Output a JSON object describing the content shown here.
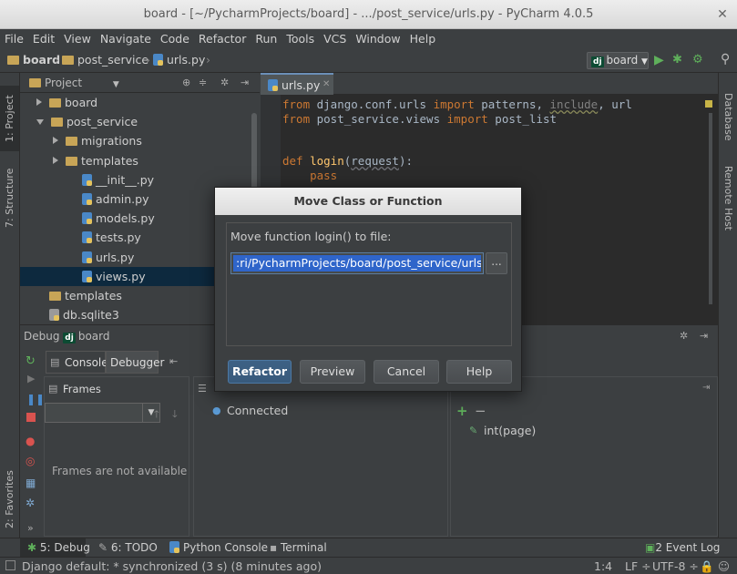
{
  "window": {
    "title": "board - [~/PycharmProjects/board] - .../post_service/urls.py - PyCharm 4.0.5"
  },
  "menu": [
    "File",
    "Edit",
    "View",
    "Navigate",
    "Code",
    "Refactor",
    "Run",
    "Tools",
    "VCS",
    "Window",
    "Help"
  ],
  "breadcrumbs": [
    "board",
    "post_service",
    "urls.py"
  ],
  "run_config": {
    "badge": "dj",
    "name": "board"
  },
  "left_stripe": {
    "project": "1: Project",
    "structure": "7: Structure",
    "favorites": "2: Favorites"
  },
  "right_stripe": {
    "database": "Database",
    "remote": "Remote Host"
  },
  "project": {
    "header": "Project",
    "tree": [
      {
        "label": "board",
        "type": "folder",
        "depth": 1,
        "arrow": "right"
      },
      {
        "label": "post_service",
        "type": "folder",
        "depth": 1,
        "arrow": "down"
      },
      {
        "label": "migrations",
        "type": "folder",
        "depth": 2,
        "arrow": "right"
      },
      {
        "label": "templates",
        "type": "folder",
        "depth": 2,
        "arrow": "right"
      },
      {
        "label": "__init__.py",
        "type": "py",
        "depth": 3
      },
      {
        "label": "admin.py",
        "type": "py",
        "depth": 3
      },
      {
        "label": "models.py",
        "type": "py",
        "depth": 3
      },
      {
        "label": "tests.py",
        "type": "py",
        "depth": 3
      },
      {
        "label": "urls.py",
        "type": "py",
        "depth": 3
      },
      {
        "label": "views.py",
        "type": "py",
        "depth": 3,
        "selected": true
      },
      {
        "label": "templates",
        "type": "folder",
        "depth": 1
      },
      {
        "label": "db.sqlite3",
        "type": "db",
        "depth": 1
      }
    ]
  },
  "editor": {
    "tab": "urls.py",
    "code": {
      "l1": [
        "from",
        " django.conf.urls ",
        "import",
        " patterns, ",
        "include",
        ", url"
      ],
      "l2": [
        "from",
        " post_service.views ",
        "import",
        " post_list"
      ],
      "l3": [
        "def",
        " ",
        "login",
        "(",
        "request",
        "):"
      ],
      "l4": [
        "    ",
        "pass"
      ]
    }
  },
  "debug": {
    "label": "Debug",
    "badge": "dj",
    "config": "board",
    "tabs": [
      "Console",
      "Debugger"
    ],
    "frames_title": "Frames",
    "frames_empty": "Frames are not available",
    "connected": "Connected",
    "variable": "int(page)"
  },
  "dialog": {
    "title": "Move Class or Function",
    "label": "Move function login() to file:",
    "path_value": ":ri/PycharmProjects/board/post_service/urls.py",
    "browse": "...",
    "buttons": {
      "refactor": "Refactor",
      "preview": "Preview",
      "cancel": "Cancel",
      "help": "Help"
    }
  },
  "bottom_tools": {
    "debug": "5: Debug",
    "todo": "6: TODO",
    "python_console": "Python Console",
    "terminal": "Terminal",
    "event_log": "2 Event Log"
  },
  "status": {
    "message": "Django default: * synchronized (3 s) (8 minutes ago)",
    "position": "1:4",
    "line_sep": "LF ÷",
    "encoding": "UTF-8 ÷"
  },
  "colors": {
    "selection": "#0d293e",
    "keyword": "#cc7832",
    "function": "#ffc66d",
    "text": "#a9b7c6",
    "accent_blue": "#2f65ca"
  }
}
